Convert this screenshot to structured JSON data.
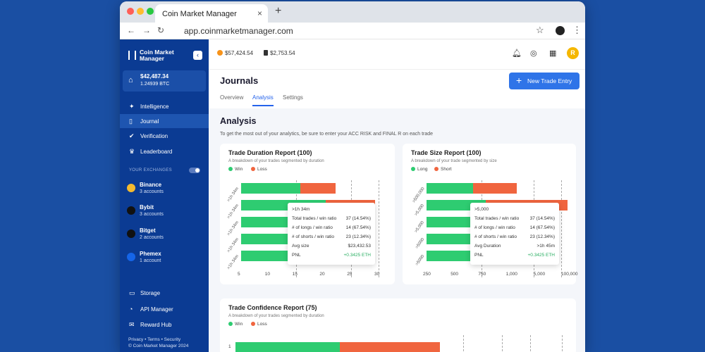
{
  "browser": {
    "tab_title": "Coin Market Manager",
    "tab_close": "×",
    "new_tab": "+",
    "url": "app.coinmarketmanager.com"
  },
  "sidebar": {
    "logo_line1": "Coin Market",
    "logo_line2": "Manager",
    "balance_usd": "$42,487.34",
    "balance_btc": "1.24939 BTC",
    "nav": [
      {
        "label": "Intelligence",
        "icon": "sparkle-icon"
      },
      {
        "label": "Journal",
        "icon": "book-icon"
      },
      {
        "label": "Verification",
        "icon": "verified-icon"
      },
      {
        "label": "Leaderboard",
        "icon": "trophy-icon"
      }
    ],
    "exchanges_label": "YOUR EXCHANGES",
    "exchanges": [
      {
        "name": "Binance",
        "accounts": "3 accounts",
        "color": "#f3ba2f"
      },
      {
        "name": "Bybit",
        "accounts": "3 accounts",
        "color": "#111111"
      },
      {
        "name": "Bitget",
        "accounts": "2 accounts",
        "color": "#111111"
      },
      {
        "name": "Phemex",
        "accounts": "1 account",
        "color": "#1565e8"
      }
    ],
    "bottom_nav": [
      {
        "label": "Storage",
        "icon": "storage-icon"
      },
      {
        "label": "API Manager",
        "icon": "signal-icon"
      },
      {
        "label": "Reward Hub",
        "icon": "gift-icon"
      }
    ],
    "footer_links": "Privacy • Terms • Security",
    "footer_copy": "© Coin Market Manager 2024"
  },
  "topbar": {
    "btc_price": "$57,424.54",
    "eth_price": "$2,753.54",
    "avatar_letter": "R"
  },
  "header": {
    "title": "Journals",
    "tabs": [
      "Overview",
      "Analysis",
      "Settings"
    ],
    "active_tab": "Analysis",
    "new_trade_label": "New Trade Entry"
  },
  "analysis": {
    "title": "Analysis",
    "subtitle": "To get the most out of your analytics, be sure to enter your ACC RISK and FINAL R on each trade"
  },
  "duration_report": {
    "title": "Trade Duration Report (100)",
    "subtitle": "A breakdown of your trades segmented by duration",
    "legend": [
      "Win",
      "Loss"
    ],
    "tooltip": {
      "header": ">1h 34m",
      "rows": [
        {
          "label": "Total trades / win ratio",
          "value": "37 (14.54%)"
        },
        {
          "label": "# of longs / win ratio",
          "value": "14 (67.54%)"
        },
        {
          "label": "# of shorts / win ratio",
          "value": "23 (12.34%)"
        },
        {
          "label": "Avg size",
          "value": "$23,432.53"
        },
        {
          "label": "PNL",
          "value": "+0.3425 ETH"
        }
      ]
    }
  },
  "size_report": {
    "title": "Trade Size Report (100)",
    "subtitle": "A breakdown of your trade segmented by size",
    "legend": [
      "Long",
      "Short"
    ],
    "tooltip": {
      "header": ">5,000",
      "rows": [
        {
          "label": "Total trades / win ratio",
          "value": "37 (14.54%)"
        },
        {
          "label": "# of longs / win ratio",
          "value": "14 (67.54%)"
        },
        {
          "label": "# of shorts / win ratio",
          "value": "23 (12.34%)"
        },
        {
          "label": "Avg Duration",
          "value": ">1h 45m"
        },
        {
          "label": "PNL",
          "value": "+0.3425 ETH"
        }
      ]
    }
  },
  "confidence_report": {
    "title": "Trade Confidence Report (75)",
    "subtitle": "A breakdown of your trades segmented by duration",
    "legend": [
      "Win",
      "Loss"
    ]
  },
  "colors": {
    "win": "#2ecc71",
    "loss": "#f0653f",
    "accent": "#2f74e8",
    "pnl": "#27ae60"
  },
  "chart_data": [
    {
      "type": "bar",
      "orientation": "horizontal",
      "stacked": true,
      "categories": [
        ">1h 34m",
        ">1h 34m",
        ">1h 34m",
        ">1h 34m",
        ">1h 34m"
      ],
      "series": [
        {
          "name": "Win",
          "values": [
            12,
            17,
            12,
            12,
            12
          ]
        },
        {
          "name": "Loss",
          "values": [
            7,
            10,
            7,
            7,
            7
          ]
        }
      ],
      "xticks": [
        "5",
        "10",
        "15",
        "20",
        "25",
        "30"
      ],
      "xlim": [
        5,
        30
      ]
    },
    {
      "type": "bar",
      "orientation": "horizontal",
      "stacked": true,
      "categories": [
        ">500,000",
        ">5,000",
        ">5,000",
        ">5000",
        ">5000"
      ],
      "series": [
        {
          "name": "Long",
          "values": [
            10500,
            13500,
            10500,
            10500,
            10500
          ]
        },
        {
          "name": "Short",
          "values": [
            10000,
            18500,
            10000,
            10000,
            10000
          ]
        }
      ],
      "xticks": [
        "250",
        "500",
        "750",
        "1,000",
        "5,000",
        "100,000"
      ]
    },
    {
      "type": "bar",
      "orientation": "horizontal",
      "stacked": true,
      "categories": [
        "1"
      ],
      "series": [
        {
          "name": "Win",
          "values": [
            0.51
          ]
        },
        {
          "name": "Loss",
          "values": [
            0.49
          ]
        }
      ]
    }
  ]
}
